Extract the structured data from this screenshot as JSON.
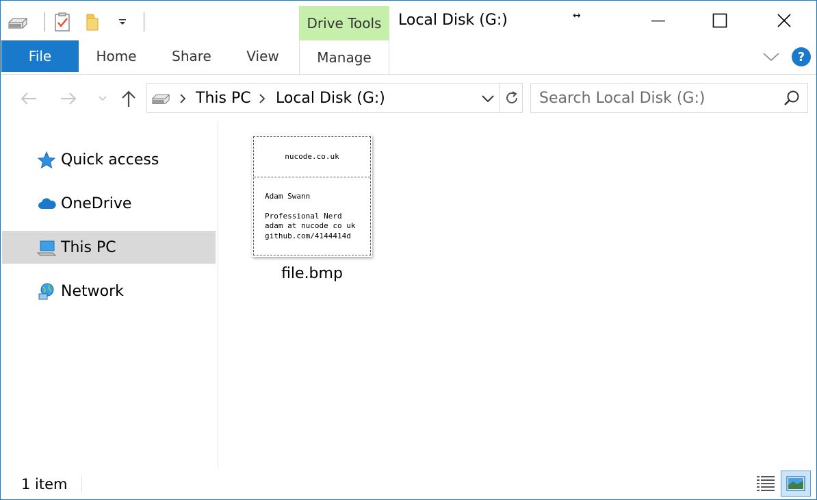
{
  "window": {
    "title": "Local Disk (G:)",
    "context_tab_group": "Drive Tools",
    "resize_glyph": "↔"
  },
  "ribbon": {
    "tabs": {
      "file": "File",
      "home": "Home",
      "share": "Share",
      "view": "View",
      "manage": "Manage"
    },
    "help": "?"
  },
  "address_bar": {
    "crumbs": [
      "This PC",
      "Local Disk (G:)"
    ]
  },
  "search": {
    "placeholder": "Search Local Disk (G:)"
  },
  "sidebar": {
    "items": [
      {
        "label": "Quick access",
        "icon": "star-icon"
      },
      {
        "label": "OneDrive",
        "icon": "cloud-icon"
      },
      {
        "label": "This PC",
        "icon": "computer-icon",
        "selected": true
      },
      {
        "label": "Network",
        "icon": "network-icon"
      }
    ]
  },
  "files": [
    {
      "name": "file.bmp",
      "thumbnail": {
        "header": "nucode.co.uk",
        "lines": [
          "Adam Swann",
          "Professional Nerd",
          "adam at nucode co uk",
          "github.com/4144414d"
        ]
      }
    }
  ],
  "status": {
    "item_count": "1 item"
  },
  "colors": {
    "accent": "#1979ca",
    "drive_tools": "#c6efab",
    "selected_nav": "#d9d9d9"
  }
}
